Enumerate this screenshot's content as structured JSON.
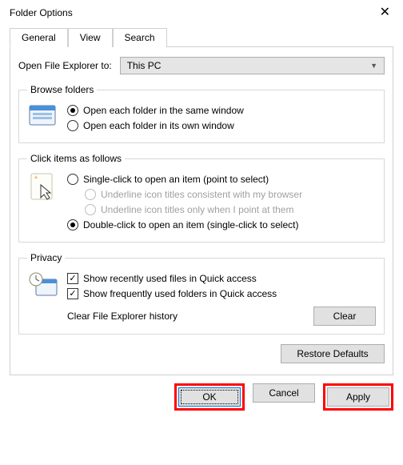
{
  "window": {
    "title": "Folder Options"
  },
  "tabs": {
    "general": "General",
    "view": "View",
    "search": "Search"
  },
  "open_row": {
    "label": "Open File Explorer to:",
    "value": "This PC"
  },
  "browse": {
    "legend": "Browse folders",
    "same_window": "Open each folder in the same window",
    "own_window": "Open each folder in its own window"
  },
  "click": {
    "legend": "Click items as follows",
    "single": "Single-click to open an item (point to select)",
    "underline_browser": "Underline icon titles consistent with my browser",
    "underline_point": "Underline icon titles only when I point at them",
    "double": "Double-click to open an item (single-click to select)"
  },
  "privacy": {
    "legend": "Privacy",
    "recent_files": "Show recently used files in Quick access",
    "frequent_folders": "Show frequently used folders in Quick access",
    "clear_label": "Clear File Explorer history",
    "clear_button": "Clear"
  },
  "buttons": {
    "restore": "Restore Defaults",
    "ok": "OK",
    "cancel": "Cancel",
    "apply": "Apply"
  }
}
